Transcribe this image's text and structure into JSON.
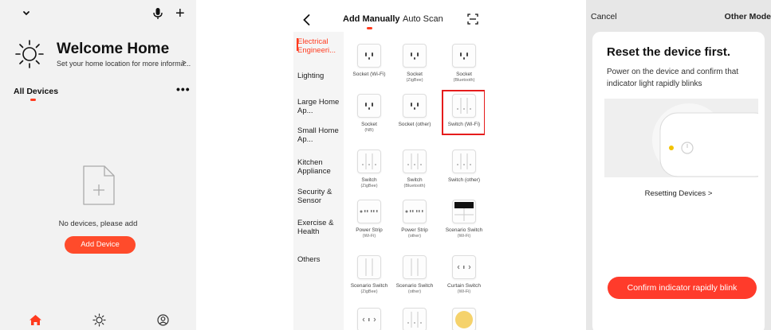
{
  "screen1": {
    "icons": {
      "chevron": "chevron-down-icon",
      "mic": "microphone-icon",
      "plus": "plus-icon",
      "weather": "sun-icon",
      "more": "more-icon"
    },
    "plus_label": "+",
    "welcome_title": "Welcome Home",
    "location_hint": "Set your home location for more informa...",
    "location_arrow": ">",
    "section_title": "All Devices",
    "more_label": "•••",
    "empty_text": "No devices, please add",
    "add_device_label": "Add Device",
    "tabs": [
      "home-icon",
      "scene-icon",
      "profile-icon"
    ],
    "accent": "#ff4b2b"
  },
  "screen2": {
    "tabs": {
      "manual": "Add Manually",
      "auto": "Auto Scan"
    },
    "categories": [
      {
        "label": "Electrical Engineeri...",
        "active": true
      },
      {
        "label": "Lighting"
      },
      {
        "label": "Large Home Ap..."
      },
      {
        "label": "Small Home Ap..."
      },
      {
        "label": "Kitchen Appliance"
      },
      {
        "label": "Security & Sensor"
      },
      {
        "label": "Exercise & Health"
      },
      {
        "label": "Others"
      }
    ],
    "devices": [
      {
        "label": "Socket (Wi-Fi)",
        "sub": "",
        "icon": "socket"
      },
      {
        "label": "Socket",
        "sub": "(ZigBee)",
        "icon": "socket"
      },
      {
        "label": "Socket",
        "sub": "(Bluetooth)",
        "icon": "socket"
      },
      {
        "label": "Socket",
        "sub": "(NB)",
        "icon": "socket"
      },
      {
        "label": "Socket (other)",
        "sub": "",
        "icon": "socket"
      },
      {
        "label": "Switch (Wi-Fi)",
        "sub": "",
        "icon": "switch"
      },
      {
        "label": "Switch",
        "sub": "(ZigBee)",
        "icon": "switch"
      },
      {
        "label": "Switch",
        "sub": "(Bluetooth)",
        "icon": "switch"
      },
      {
        "label": "Switch (other)",
        "sub": "",
        "icon": "switch"
      },
      {
        "label": "Power Strip",
        "sub": "(Wi-Fi)",
        "icon": "strip"
      },
      {
        "label": "Power Strip",
        "sub": "(other)",
        "icon": "strip"
      },
      {
        "label": "Scenario Switch",
        "sub": "(Wi-Fi)",
        "icon": "scenario"
      },
      {
        "label": "Scenario Switch",
        "sub": "(ZigBee)",
        "icon": "panel"
      },
      {
        "label": "Scenario Switch",
        "sub": "(other)",
        "icon": "panel"
      },
      {
        "label": "Curtain Switch",
        "sub": "(Wi-Fi)",
        "icon": "curtain"
      },
      {
        "label": "",
        "sub": "",
        "icon": "curtain"
      },
      {
        "label": "",
        "sub": "",
        "icon": "switch"
      },
      {
        "label": "",
        "sub": "",
        "icon": "bulb"
      }
    ],
    "selected_index": 5,
    "accent": "#ff3b1f"
  },
  "screen3": {
    "cancel_label": "Cancel",
    "other_mode_label": "Other Mode",
    "title": "Reset the device first.",
    "description": "Power on the device and confirm that indicator light rapidly blinks",
    "resetting_link": "Resetting Devices >",
    "confirm_label": "Confirm indicator rapidly blink",
    "indicator_color": "#f2c200",
    "accent": "#ff3b2b"
  }
}
